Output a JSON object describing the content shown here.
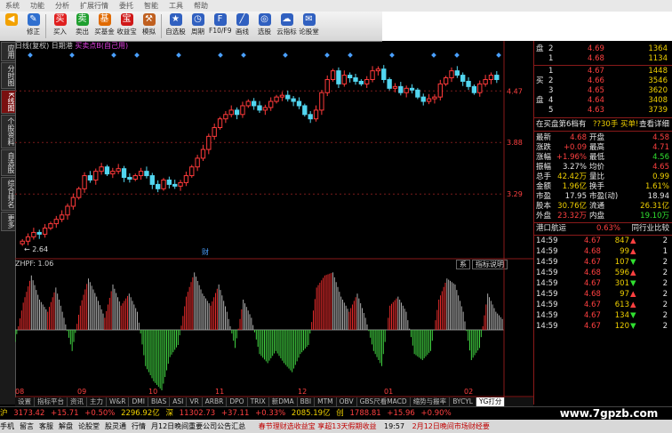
{
  "menu": [
    "系统",
    "功能",
    "分析",
    "扩展行情",
    "委托",
    "智能",
    "工具",
    "帮助"
  ],
  "toolbar": [
    {
      "label": "",
      "icon": "back-icon",
      "color": "#f2a100"
    },
    {
      "label": "修正",
      "icon": "edit-icon",
      "color": "#2f6fcf"
    },
    {
      "label": "买入",
      "icon": "buy-icon",
      "color": "#e02020"
    },
    {
      "label": "卖出",
      "icon": "sell-icon",
      "color": "#1f9f2f"
    },
    {
      "label": "买基金",
      "icon": "fund-icon",
      "color": "#e06a00"
    },
    {
      "label": "收益宝",
      "icon": "treasure-icon",
      "color": "#d01818"
    },
    {
      "label": "模拟",
      "icon": "simulate-icon",
      "color": "#c06020"
    },
    {
      "label": "自选股",
      "icon": "favorites-icon",
      "color": "#3060c0"
    },
    {
      "label": "周期",
      "icon": "period-icon",
      "color": "#3060c0"
    },
    {
      "label": "F10/F9",
      "icon": "f10-icon",
      "color": "#3060c0"
    },
    {
      "label": "画线",
      "icon": "draw-line-icon",
      "color": "#3060c0"
    },
    {
      "label": "选股",
      "icon": "stock-select-icon",
      "color": "#3060c0"
    },
    {
      "label": "云指标",
      "icon": "cloud-indicator-icon",
      "color": "#3060c0"
    },
    {
      "label": "论股堂",
      "icon": "forum-icon",
      "color": "#3060c0"
    }
  ],
  "side_tabs": [
    {
      "label": "应用",
      "active": false
    },
    {
      "label": "分时图",
      "active": false
    },
    {
      "label": "K线图",
      "active": true
    },
    {
      "label": "个股资料",
      "active": false
    },
    {
      "label": "自选股",
      "active": false
    },
    {
      "label": "综合排名",
      "active": false
    },
    {
      "label": "更多",
      "active": false
    }
  ],
  "chart_header": {
    "text": "日线(复权)  日期港",
    "highlight": "买卖点B(自己用)"
  },
  "indicator_header": "ZHPF: 1.06",
  "indicator_buttons": [
    "系",
    "指标说明"
  ],
  "price_axis": [
    "4.47",
    "3.88",
    "3.29"
  ],
  "price_low_label": "2.64",
  "fin_marker": "财",
  "x_labels": [
    "08",
    "09",
    "10",
    "11",
    "12",
    "01",
    "02"
  ],
  "bottom_tabs": [
    "设置",
    "指标平台",
    "资讯",
    "主力",
    "W&R",
    "DMI",
    "BIAS",
    "ASI",
    "VR",
    "ARBR",
    "DPO",
    "TRIX",
    "新DMA",
    "BBI",
    "MTM",
    "OBV",
    "GBS尺看MACD",
    "缩势与搬率",
    "BYCYL",
    "YG打分"
  ],
  "chart_data": [
    {
      "type": "candlestick",
      "title": "",
      "ylim": [
        2.6,
        4.9
      ],
      "yticks": [
        4.47,
        3.88,
        3.29
      ],
      "close": [
        2.75,
        2.8,
        2.85,
        2.83,
        2.9,
        2.95,
        3.0,
        3.05,
        3.15,
        3.25,
        3.35,
        3.5,
        3.45,
        3.55,
        3.6,
        3.52,
        3.55,
        3.58,
        3.48,
        3.46,
        3.5,
        3.55,
        3.5,
        3.4,
        3.35,
        3.45,
        3.4,
        3.38,
        3.42,
        3.5,
        3.6,
        3.7,
        3.8,
        3.95,
        4.05,
        4.15,
        4.2,
        4.25,
        4.2,
        4.3,
        4.35,
        4.3,
        4.25,
        4.28,
        4.35,
        4.4,
        4.42,
        4.38,
        4.35,
        4.3,
        4.2,
        4.15,
        4.25,
        4.45,
        4.6,
        4.7,
        4.55,
        4.65,
        4.62,
        4.58,
        4.55,
        4.6,
        4.7,
        4.72,
        4.6,
        4.5,
        4.52,
        4.45,
        4.5,
        4.48,
        4.4,
        4.35,
        4.38,
        4.4,
        4.55,
        4.62,
        4.7,
        4.65,
        4.58,
        4.52,
        4.45,
        4.55,
        4.6,
        4.65,
        4.6
      ],
      "volatility": 0.06
    },
    {
      "type": "bar",
      "title": "ZHPF: 1.06",
      "ylim": [
        -1,
        1
      ],
      "values": [
        -0.2,
        0.45,
        0.9,
        0.5,
        0.3,
        0.7,
        0.2,
        -0.35,
        0.4,
        0.85,
        0.55,
        0.2,
        0.75,
        0.4,
        0.6,
        0.3,
        -0.6,
        -0.85,
        -1.0,
        -0.45,
        -0.25,
        0.55,
        0.95,
        0.6,
        0.4,
        0.75,
        0.3,
        -0.3,
        0.5,
        0.2,
        -0.4,
        -0.55,
        -0.35,
        -0.55,
        -0.7,
        -0.4,
        -0.25,
        0.7,
        0.9,
        0.95,
        0.55,
        0.3,
        0.6,
        0.2,
        -0.35,
        -0.6,
        0.4,
        0.55,
        0.3,
        -0.4,
        -0.5,
        -0.35,
        0.5,
        0.85,
        0.75,
        0.3,
        -0.5,
        -0.3,
        0.6,
        0.3,
        0.15
      ],
      "colors": {
        "positive": "#e02a2a",
        "neutral": "#aaaaaa",
        "negative": "#40d040"
      }
    }
  ],
  "orderbook": {
    "sell": [
      {
        "label": "盘",
        "level": "2",
        "price": "4.69",
        "vol": "1364"
      },
      {
        "level": "1",
        "price": "4.68",
        "vol": "1134"
      }
    ],
    "mid": [
      {
        "level": "1",
        "price": "4.67",
        "vol": "1448"
      }
    ],
    "buy": [
      {
        "level": "2",
        "price": "4.66",
        "vol": "3546"
      },
      {
        "level": "3",
        "price": "4.65",
        "vol": "3620"
      },
      {
        "level": "4",
        "price": "4.64",
        "vol": "3408"
      },
      {
        "level": "5",
        "price": "4.63",
        "vol": "3739"
      }
    ],
    "buy_labels": [
      "买",
      "盘"
    ]
  },
  "detail_bar": {
    "left": "在买盘第6档有",
    "mid": "??30手 买单!",
    "right": "查看详细"
  },
  "stats": [
    {
      "l1": "最新",
      "v1": "4.68",
      "c1": "red",
      "l2": "开盘",
      "v2": "4.58",
      "c2": "red"
    },
    {
      "l1": "涨跌",
      "v1": "+0.09",
      "c1": "red",
      "l2": "最高",
      "v2": "4.71",
      "c2": "red"
    },
    {
      "l1": "涨幅",
      "v1": "+1.96%",
      "c1": "red",
      "l2": "最低",
      "v2": "4.56",
      "c2": "grn"
    },
    {
      "l1": "振幅",
      "v1": "3.27%",
      "c1": "wht",
      "l2": "均价",
      "v2": "4.65",
      "c2": "red"
    },
    {
      "l1": "总手",
      "v1": "42.42万",
      "c1": "yel",
      "l2": "量比",
      "v2": "0.99",
      "c2": "yel"
    },
    {
      "l1": "金额",
      "v1": "1.96亿",
      "c1": "yel",
      "l2": "换手",
      "v2": "1.61%",
      "c2": "yel"
    },
    {
      "l1": "市盈",
      "v1": "17.95",
      "c1": "wht",
      "l2": "市盈(动)",
      "v2": "18.94",
      "c2": "wht"
    },
    {
      "l1": "股本",
      "v1": "30.76亿",
      "c1": "yel",
      "l2": "流通",
      "v2": "26.31亿",
      "c2": "yel"
    },
    {
      "l1": "外盘",
      "v1": "23.32万",
      "c1": "red",
      "l2": "内盘",
      "v2": "19.10万",
      "c2": "grn"
    }
  ],
  "tradelist_header": {
    "left": "港口航运",
    "mid": "0.63%",
    "right": "同行业比较"
  },
  "trades": [
    {
      "time": "14:59",
      "price": "4.67",
      "vol": "847",
      "dir": "up",
      "n": "2"
    },
    {
      "time": "14:59",
      "price": "4.68",
      "vol": "99",
      "dir": "up",
      "n": "1"
    },
    {
      "time": "14:59",
      "price": "4.67",
      "vol": "107",
      "dir": "down",
      "n": "2"
    },
    {
      "time": "14:59",
      "price": "4.68",
      "vol": "596",
      "dir": "up",
      "n": "2"
    },
    {
      "time": "14:59",
      "price": "4.67",
      "vol": "301",
      "dir": "down",
      "n": "2"
    },
    {
      "time": "14:59",
      "price": "4.68",
      "vol": "97",
      "dir": "up",
      "n": "2"
    },
    {
      "time": "14:59",
      "price": "4.67",
      "vol": "613",
      "dir": "up",
      "n": "2"
    },
    {
      "time": "14:59",
      "price": "4.67",
      "vol": "134",
      "dir": "down",
      "n": "2"
    },
    {
      "time": "14:59",
      "price": "4.67",
      "vol": "120",
      "dir": "down",
      "n": "2"
    }
  ],
  "status": {
    "sh_label": "沪",
    "sh_val": "3173.42",
    "sh_chg": "+15.71",
    "sh_pct": "+0.50%",
    "sh_amt": "2296.92亿",
    "sz_label": "深",
    "sz_val": "11302.73",
    "sz_chg": "+37.11",
    "sz_pct": "+0.33%",
    "sz_amt": "2085.19亿",
    "cy_label": "创",
    "cy_val": "1788.81",
    "cy_chg": "+15.96",
    "cy_pct": "+0.90%"
  },
  "ticker": {
    "items": [
      "手机",
      "留言",
      "客服",
      "解盘",
      "论股堂",
      "股灵通",
      "行情",
      "月12日晚间重要公司公告汇总"
    ],
    "news1": "春节理财选收益宝 享超13天假期收益",
    "clock": "19:57",
    "news2": "2月12日晚间市场财经要"
  },
  "watermark": "www.7gpzb.com"
}
